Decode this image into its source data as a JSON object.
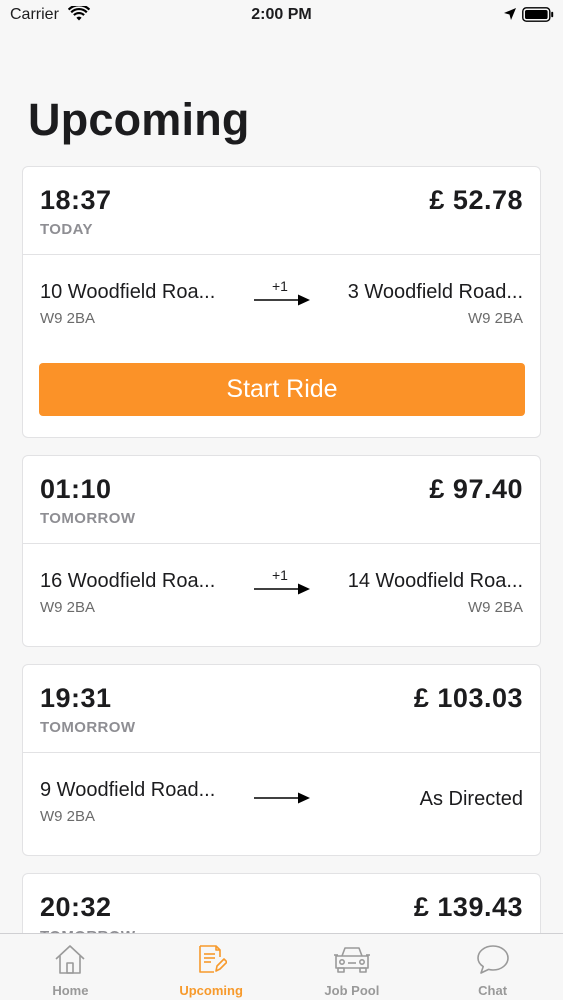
{
  "status_bar": {
    "carrier": "Carrier",
    "time": "2:00 PM"
  },
  "page": {
    "title": "Upcoming"
  },
  "rides": [
    {
      "time": "18:37",
      "day": "TODAY",
      "price": "£ 52.78",
      "from": "10 Woodfield Roa...",
      "from_postcode": "W9 2BA",
      "extra_stops": "+1",
      "to": "3 Woodfield Road...",
      "to_postcode": "W9 2BA",
      "action": "Start Ride"
    },
    {
      "time": "01:10",
      "day": "TOMORROW",
      "price": "£ 97.40",
      "from": "16 Woodfield Roa...",
      "from_postcode": "W9 2BA",
      "extra_stops": "+1",
      "to": "14 Woodfield Roa...",
      "to_postcode": "W9 2BA"
    },
    {
      "time": "19:31",
      "day": "TOMORROW",
      "price": "£ 103.03",
      "from": "9 Woodfield Road...",
      "from_postcode": "W9 2BA",
      "to": "As Directed"
    },
    {
      "time": "20:32",
      "day": "TOMORROW",
      "price": "£ 139.43"
    }
  ],
  "tabs": [
    {
      "label": "Home",
      "icon": "home-icon"
    },
    {
      "label": "Upcoming",
      "icon": "document-edit-icon",
      "active": true
    },
    {
      "label": "Job Pool",
      "icon": "car-icon"
    },
    {
      "label": "Chat",
      "icon": "chat-bubble-icon"
    }
  ],
  "colors": {
    "accent": "#fb9228",
    "active_tab": "#f79a2c",
    "inactive_tab": "#999999",
    "background": "#f7f7f7"
  }
}
